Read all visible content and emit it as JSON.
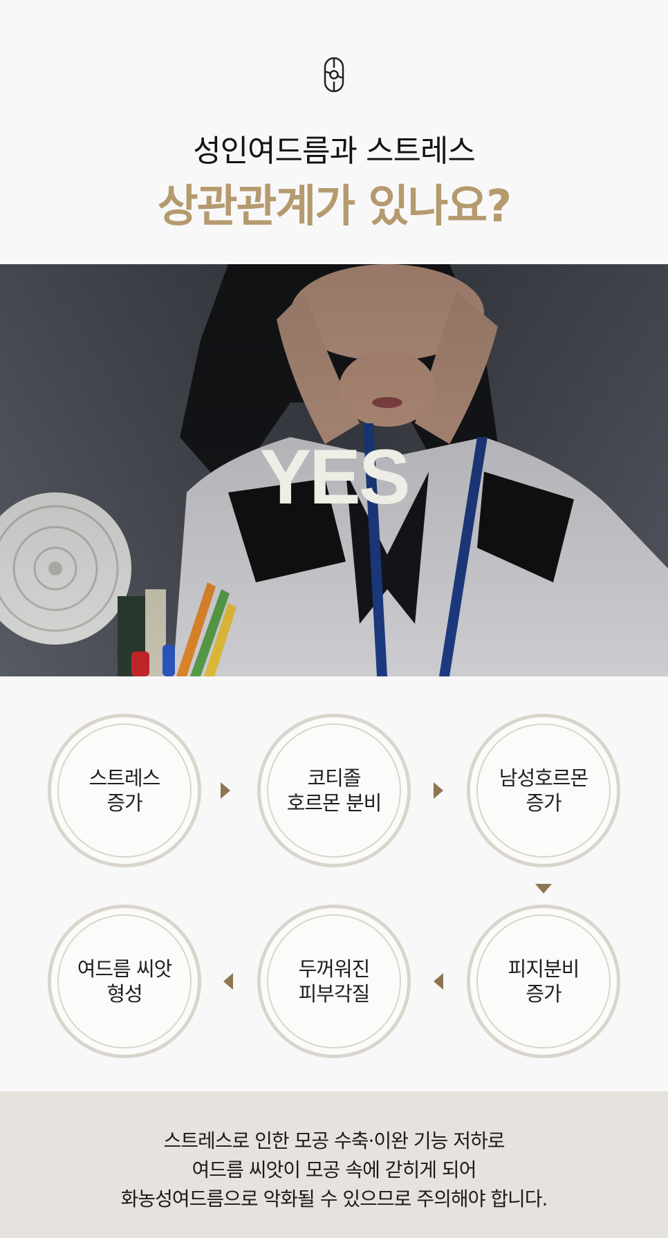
{
  "header": {
    "logo_icon": "brand-emblem-icon",
    "title_line1": "성인여드름과 스트레스",
    "title_line2": "상관관계가 있나요?",
    "accent_color": "#b49a6e"
  },
  "hero": {
    "image": "stressed-woman-photo",
    "answer": "YES"
  },
  "flow": {
    "steps": [
      {
        "line1": "스트레스",
        "line2": "증가"
      },
      {
        "line1": "코티졸",
        "line2": "호르몬 분비"
      },
      {
        "line1": "남성호르몬",
        "line2": "증가"
      },
      {
        "line1": "피지분비",
        "line2": "증가"
      },
      {
        "line1": "두꺼워진",
        "line2": "피부각질"
      },
      {
        "line1": "여드름 씨앗",
        "line2": "형성"
      }
    ],
    "arrow_color": "#8d7650"
  },
  "footer": {
    "lines": [
      "스트레스로 인한 모공 수축·이완 기능 저하로",
      "여드름 씨앗이 모공 속에 갇히게 되어",
      "화농성여드름으로 악화될 수 있으므로 주의해야 합니다."
    ]
  }
}
